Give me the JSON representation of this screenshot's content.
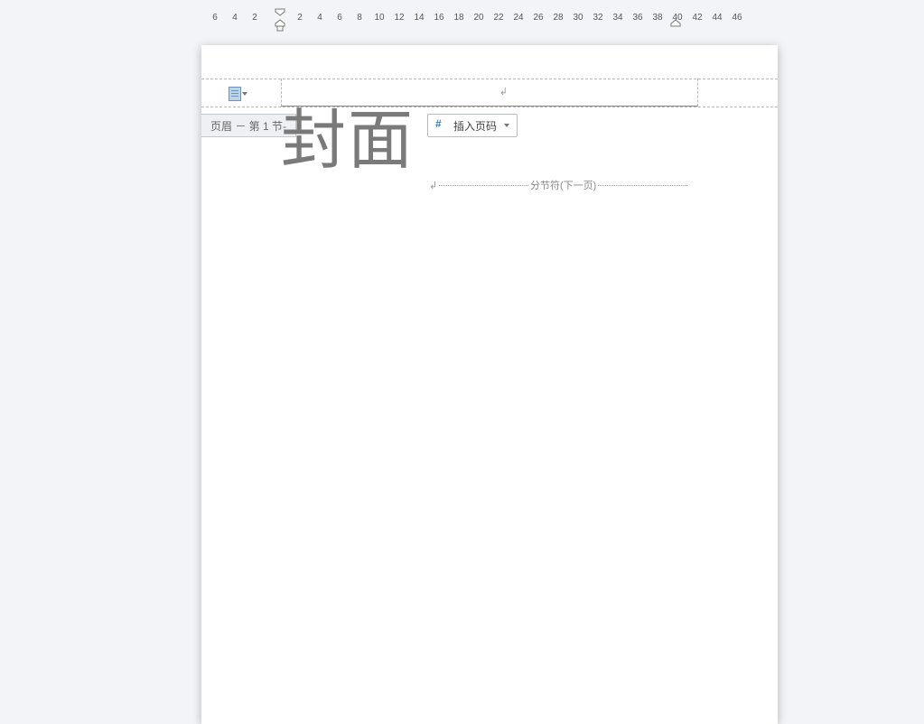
{
  "ruler": {
    "left_numbers": [
      6,
      4,
      2
    ],
    "right_numbers": [
      2,
      4,
      6,
      8,
      10,
      12,
      14,
      16,
      18,
      20,
      22,
      24,
      26,
      28,
      30,
      32,
      34,
      36,
      38,
      40,
      42,
      44,
      46
    ]
  },
  "header": {
    "tab_label": "页眉 － 第 1 节-",
    "insert_page_number_label": "插入页码",
    "paragraph_mark": "↲"
  },
  "document": {
    "title_text": "封面",
    "section_break_label": "分节符(下一页)",
    "section_break_mark": "↲"
  }
}
